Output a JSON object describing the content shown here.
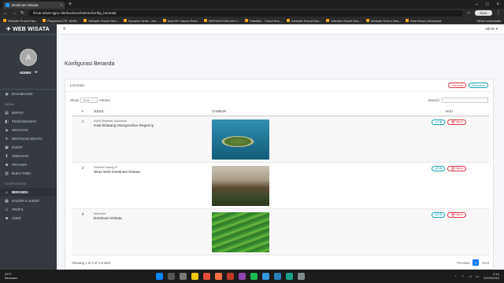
{
  "browser": {
    "tab_title": "Destinasi Wisata",
    "new_tab": "+",
    "url": "lincar.wisat-sgpu.site/backend/admin/konfig_beranda",
    "profile": "Eecs",
    "bookmarks": [
      "Website Rozmi Des...",
      "Paywrest CTE 19/09...",
      "Website Rozmi Des...",
      "Dynamic Drive - fav...",
      "Asal HP Xiaomi Redi...",
      "BERSAKITABLAN C...",
      "Pakadlin - Cloud Hos...",
      "Website Rozmi Des...",
      "Website Rozmi Des...",
      "Website Rozmi Des...",
      "Web Desa | Indonesia"
    ],
    "other_bookmarks": "Other bookmarks"
  },
  "sidebar": {
    "brand": "WEB WISATA",
    "avatar_letter": "A",
    "user_name": "ADMIN",
    "items_top": [
      {
        "label": "DASHBOARD",
        "icon": "dashboard-icon"
      }
    ],
    "menu_header": "MENU",
    "items_menu": [
      {
        "label": "BERITA",
        "icon": "news-icon",
        "chevron": true
      },
      {
        "label": "PENGUMUMAN",
        "icon": "announcement-icon",
        "chevron": false
      },
      {
        "label": "KEGIATAN",
        "icon": "activity-icon",
        "chevron": false
      },
      {
        "label": "DESTINASI WISATA",
        "icon": "destination-icon",
        "chevron": true
      },
      {
        "label": "EVENT",
        "icon": "event-icon",
        "chevron": false
      },
      {
        "label": "UNDUHAN",
        "icon": "download-icon",
        "chevron": false
      },
      {
        "label": "PEGAWAI",
        "icon": "employee-icon",
        "chevron": true
      },
      {
        "label": "BUKU TAMU",
        "icon": "guestbook-icon",
        "chevron": false
      }
    ],
    "config_header": "KONFIGURASI",
    "items_config": [
      {
        "label": "BERANDA",
        "icon": "home-icon",
        "chevron": false,
        "active": true
      },
      {
        "label": "GALERI & ALBUM",
        "icon": "gallery-icon",
        "chevron": false
      },
      {
        "label": "PROFIL",
        "icon": "profile-icon",
        "chevron": true
      },
      {
        "label": "USER",
        "icon": "user-icon",
        "chevron": true
      }
    ]
  },
  "topbar": {
    "menu_icon": "≡",
    "user": "admin"
  },
  "page": {
    "title": "Konfigurasi Beranda",
    "card_title": "List Data",
    "btn_back": "Kembali",
    "btn_add": "Tambah",
    "show_label": "Show",
    "show_value": "10",
    "entries_label": "entries",
    "search_label": "Search:"
  },
  "table": {
    "headers": [
      "#",
      "JUDUL",
      "GAMBAR",
      "AKSI"
    ],
    "rows": [
      {
        "no": "1",
        "sub": "North Sulawesi, Indonesia",
        "title": "East Bolaang Mongondow Regency",
        "image": "island-aerial"
      },
      {
        "no": "2",
        "sub": "Selamat Datang di",
        "title": "Situs Web Destinasi Wisata",
        "image": "valley-landscape"
      },
      {
        "no": "3",
        "sub": "Welcome~",
        "title": "Destinasi Wisata",
        "image": "rice-terrace"
      }
    ],
    "edit_label": "Edit",
    "delete_label": "Hapus"
  },
  "footer": {
    "info": "Showing 1 to 3 of 3 entries",
    "prev": "Previous",
    "page": "1",
    "next": "Next"
  },
  "taskbar": {
    "temp": "29°C",
    "weather": "Berawan",
    "time": "2:14",
    "date": "21/06/2022"
  }
}
